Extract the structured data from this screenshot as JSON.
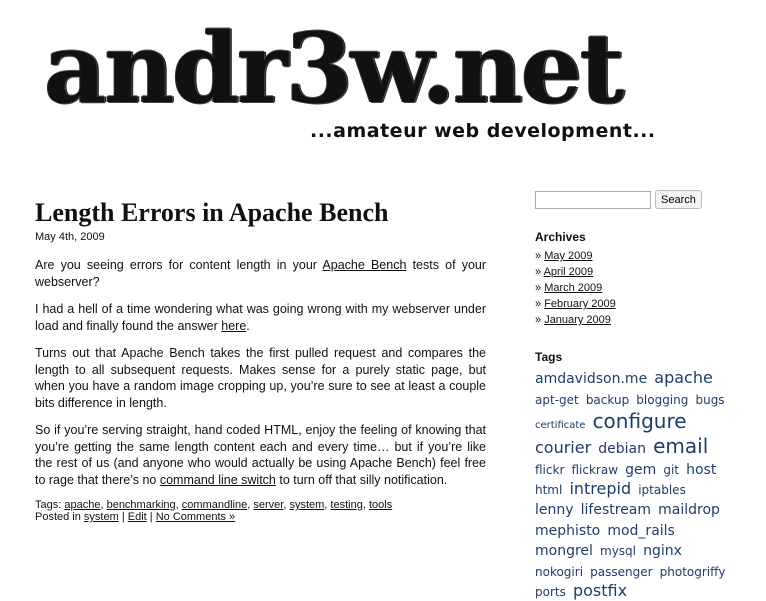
{
  "header": {
    "site_title": "andr3w.net",
    "tagline": "...amateur web development..."
  },
  "post": {
    "title": "Length Errors in Apache Bench",
    "date": "May 4th, 2009",
    "p1_before": "Are you seeing errors for content length in your ",
    "p1_link": "Apache Bench",
    "p1_after": " tests of your webserver?",
    "p2_before": "I had a hell of a time wondering what was going wrong with my webserver under load and finally found the answer ",
    "p2_link": "here",
    "p2_after": ".",
    "p3": "Turns out that Apache Bench takes the first pulled request and compares the length to all subsequent requests. Makes sense for a purely static page, but when you have a random image cropping up, you’re sure to see at least a couple bits difference in length.",
    "p4_before": "So if you’re serving straight, hand coded HTML, enjoy the feeling of knowing that you’re getting the same length content each and every time… but if you’re like the rest of us (and anyone who would actually be using Apache Bench) feel free to rage that there’s no ",
    "p4_link": "command line switch",
    "p4_after": " to turn off that silly notification.",
    "tags_label": "Tags: ",
    "tags": [
      "apache",
      "benchmarking",
      "commandline",
      "server",
      "system",
      "testing",
      "tools"
    ],
    "posted_in_label": "Posted in ",
    "category": "system",
    "edit_label": "Edit",
    "comments_label": "No Comments »"
  },
  "sidebar": {
    "search_placeholder": "",
    "search_button": "Search",
    "archives_title": "Archives",
    "archives": [
      "May 2009",
      "April 2009",
      "March 2009",
      "February 2009",
      "January 2009"
    ],
    "tags_title": "Tags",
    "tag_cloud": [
      {
        "label": "amdavidson.me",
        "size": 3
      },
      {
        "label": "apache",
        "size": 4
      },
      {
        "label": "apt-get",
        "size": 2
      },
      {
        "label": "backup",
        "size": 2
      },
      {
        "label": "blogging",
        "size": 2
      },
      {
        "label": "bugs",
        "size": 2
      },
      {
        "label": "certificate",
        "size": 1
      },
      {
        "label": "configure",
        "size": 5
      },
      {
        "label": "courier",
        "size": 4
      },
      {
        "label": "debian",
        "size": 3
      },
      {
        "label": "email",
        "size": 5
      },
      {
        "label": "flickr",
        "size": 2
      },
      {
        "label": "flickraw",
        "size": 2
      },
      {
        "label": "gem",
        "size": 3
      },
      {
        "label": "git",
        "size": 2
      },
      {
        "label": "host",
        "size": 3
      },
      {
        "label": "html",
        "size": 2
      },
      {
        "label": "intrepid",
        "size": 4
      },
      {
        "label": "iptables",
        "size": 2
      },
      {
        "label": "lenny",
        "size": 3
      },
      {
        "label": "lifestream",
        "size": 3
      },
      {
        "label": "maildrop",
        "size": 3
      },
      {
        "label": "mephisto",
        "size": 3
      },
      {
        "label": "mod_rails",
        "size": 3
      },
      {
        "label": "mongrel",
        "size": 3
      },
      {
        "label": "mysql",
        "size": 2
      },
      {
        "label": "nginx",
        "size": 3
      },
      {
        "label": "nokogiri",
        "size": 2
      },
      {
        "label": "passenger",
        "size": 2
      },
      {
        "label": "photogriffy",
        "size": 2
      },
      {
        "label": "ports",
        "size": 2
      },
      {
        "label": "postfix",
        "size": 4
      }
    ]
  },
  "colors": {
    "tag_color": "#1f3d6b",
    "text": "#111111"
  }
}
